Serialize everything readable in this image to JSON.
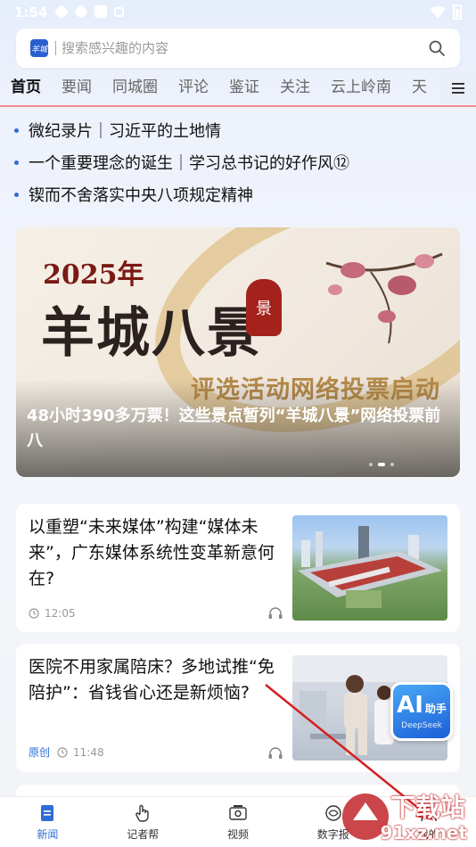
{
  "status_bar": {
    "time": "1:54"
  },
  "search": {
    "logo_text": "羊城",
    "placeholder": "搜索感兴趣的内容"
  },
  "tabs": [
    "首页",
    "要闻",
    "同城圈",
    "评论",
    "鉴证",
    "关注",
    "云上岭南",
    "天"
  ],
  "headlines": [
    "微纪录片｜习近平的土地情",
    "一个重要理念的诞生｜学习总书记的好作风⑫",
    "锲而不舍落实中央八项规定精神"
  ],
  "banner": {
    "year": "2025年",
    "title": "羊城八景",
    "seal": "景",
    "subtitle": "评选活动网络投票启动",
    "caption": "48小时390多万票！这些景点暂列“羊城八景”网络投票前八"
  },
  "news": [
    {
      "title": "以重塑“未来媒体”构建“媒体未来”，广东媒体系统性变革新意何在?",
      "origin": "",
      "time": "12:05"
    },
    {
      "title": "医院不用家属陪床？多地试推“免陪护”：省钱省心还是新烦恼?",
      "origin": "原创",
      "time": "11:48"
    }
  ],
  "ai_badge": {
    "text": "AI",
    "side": "助手",
    "sub": "DeepSeek"
  },
  "bottom_nav": [
    {
      "label": "新闻",
      "icon": "news-icon"
    },
    {
      "label": "记者帮",
      "icon": "hand-icon"
    },
    {
      "label": "视频",
      "icon": "video-icon"
    },
    {
      "label": "数字报",
      "icon": "newspaper-icon"
    },
    {
      "label": "我的",
      "icon": "profile-icon"
    }
  ],
  "watermark": {
    "text": "下载站",
    "sub": "91xz.net"
  },
  "colors": {
    "accent": "#2e6dd6",
    "tab_underline": "#f28a8a",
    "banner_seal": "#a4221c"
  }
}
